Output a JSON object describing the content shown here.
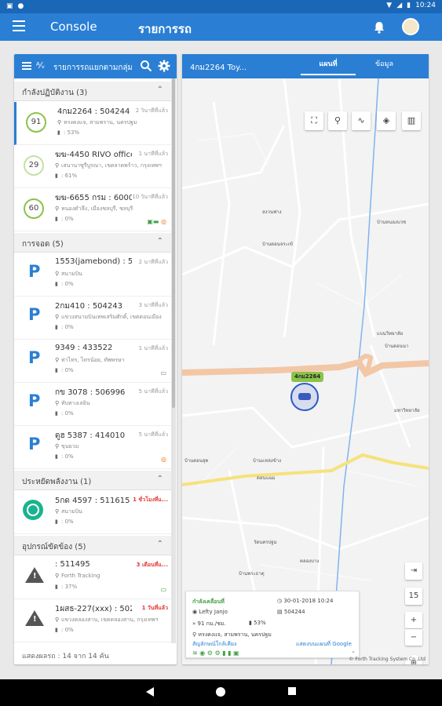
{
  "status_bar": {
    "time": "10:24"
  },
  "app_bar": {
    "console_label": "Console",
    "title": "รายการรถ"
  },
  "list_panel": {
    "title": "รายการรถแยกตามกลุ่ม",
    "groups": [
      {
        "label": "กำลังปฏิบัติงาน (3)",
        "items": [
          {
            "badge": "91",
            "name": "4กม2264 : 504244",
            "time": "2 วินาทีที่แล้ว",
            "location": "หรงคงแจ, สามพราน, นครปฐม",
            "fuel": ": 53%"
          },
          {
            "badge": "29",
            "name": "ฆฆ-4450 RIVO office ...",
            "time": "1 นาทีที่แล้ว",
            "location": "เสนานาซูรีบูรณา, เขตลาดพร้าว, กรุงเทพฯ",
            "fuel": ": 61%"
          },
          {
            "badge": "60",
            "name": "ฆฆ-6655 กรม : 6000...",
            "time": "10 วินาทีที่แล้ว",
            "location": "หนองตำลึง, เมืองชลบุรี, ชลบุรี",
            "fuel": ": 0%"
          }
        ]
      },
      {
        "label": "การจอด (5)",
        "items": [
          {
            "name": "1553(jamebond) : 513...",
            "time": "2 นาทีที่แล้ว",
            "location": "สนามบิน",
            "fuel": ": 0%"
          },
          {
            "name": "2กม410 : 504243",
            "time": "3 นาทีที่แล้ว",
            "location": "แขวงสนามบินเทพเสริมศักดิ์, เขตดอนเมือง",
            "fuel": ": 0%"
          },
          {
            "name": "9349 : 433522",
            "time": "1 นาทีที่แล้ว",
            "location": "ท่าไทร, ไทรน้อย, ทัพพรษา",
            "fuel": ": 0%"
          },
          {
            "name": "กข 3078 : 506996",
            "time": "5 นาทีที่แล้ว",
            "location": "ทับทางเลยิน",
            "fuel": ": 0%"
          },
          {
            "name": "ดูฮ 5387 : 414010",
            "time": "5 นาทีที่แล้ว",
            "location": "ขุนยวม",
            "fuel": ": 0%"
          }
        ]
      },
      {
        "label": "ประหยัดพลังงาน (1)",
        "items": [
          {
            "name": "5กด 4597 : 511615",
            "time": "1 ชั่วโมงที่แ...",
            "location": "สนามบิน",
            "fuel": ": 0%"
          }
        ]
      },
      {
        "label": "อุปกรณ์ขัดข้อง (5)",
        "items": [
          {
            "name": ": 511495",
            "time": "3 เดือนที่แ...",
            "location": "Forth Tracking",
            "fuel": ": 37%"
          },
          {
            "name": "1ผสธ-227(xxx) : 5029...",
            "time": "1 วันที่แล้ว",
            "location": "แขวงคลองสาน, เขตคลองสาน, กรุงเทพฯ",
            "fuel": ": 0%"
          }
        ]
      }
    ],
    "footer": "แสดงผลรถ : 14 จาก 14 คัน"
  },
  "map_panel": {
    "vehicle_title": "4กม2264 Toy...",
    "tabs": [
      "แผนที่",
      "ข้อมูล"
    ],
    "car_label": "4กม2264",
    "zoom_level": "15",
    "place_labels": [
      "สงวนฟาง",
      "บ้านดอนจระเข้",
      "บ้านหนองบวช",
      "บ้านดอนนา",
      "บ้านดอนสุด",
      "บ้านแหล่งข้าง",
      "ดอนแฉม",
      "มหาวิทยาลัย",
      "บ้านพระธาตุ",
      "คลองบาง",
      "วัดนครปฐม",
      "แบนวิทยาลัย"
    ],
    "info": {
      "status": "กำลังเคลื่อนที่",
      "datetime": "30-01-2018 10:24",
      "driver": "Lefty Janjo",
      "device": "504244",
      "speed": "91 กม./ชม.",
      "fuel": "53%",
      "address": "หรงคงแจ, สามพราน, นครปฐม",
      "nearby_link": "สัญลักษณ์ใกล้เคียง",
      "google_link": "แสดงบนแผนที่ Google"
    },
    "copyright": "© Forth Tracking System Co.,Ltd"
  },
  "colors": {
    "primary": "#2a7fd4",
    "status_bar": "#1a67b8",
    "moving": "#8bc34a",
    "alert": "#e53935"
  }
}
